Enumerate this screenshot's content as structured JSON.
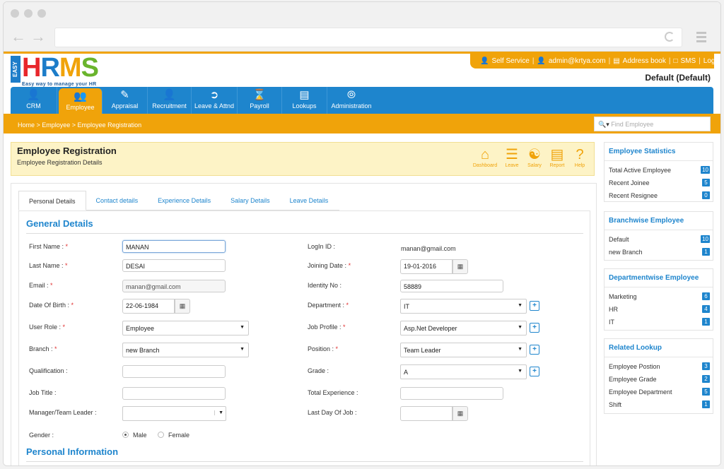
{
  "top_links": {
    "self_service": "Self Service",
    "user": "admin@krtya.com",
    "address_book": "Address book",
    "sms": "SMS",
    "logout": "Logout"
  },
  "logo": {
    "side": "EASY",
    "letters": [
      "H",
      "R",
      "M",
      "S"
    ],
    "tagline": "Easy way to manage your HR",
    "colors": [
      "#e8262b",
      "#1d7dc9",
      "#f0a30a",
      "#6ab42d"
    ]
  },
  "company": "Default (Default)",
  "nav": [
    {
      "label": "CRM",
      "icon": "user-icon"
    },
    {
      "label": "Employee",
      "icon": "users-icon"
    },
    {
      "label": "Appraisal",
      "icon": "edit-icon"
    },
    {
      "label": "Recruitment",
      "icon": "recruit-icon"
    },
    {
      "label": "Leave & Attnd",
      "icon": "exit-icon"
    },
    {
      "label": "Payroll",
      "icon": "hourglass-icon"
    },
    {
      "label": "Lookups",
      "icon": "lookup-icon"
    },
    {
      "label": "Administration",
      "icon": "compass-icon"
    }
  ],
  "breadcrumb": "Home > Employee > Employee Registration",
  "search": {
    "placeholder": "Find Employee"
  },
  "title": {
    "heading": "Employee Registration",
    "sub": "Employee Registration Details"
  },
  "toolbar": [
    "Dashboard",
    "Leave",
    "Salary",
    "Report",
    "Help"
  ],
  "tabs": [
    "Personal Details",
    "Contact details",
    "Experience Details",
    "Salary Details",
    "Leave Details"
  ],
  "sections": {
    "general": "General Details",
    "personal": "Personal Information"
  },
  "form": {
    "first_name": {
      "label": "First Name :",
      "value": "MANAN"
    },
    "last_name": {
      "label": "Last Name :",
      "value": "DESAI"
    },
    "email": {
      "label": "Email :",
      "value": "manan@gmail.com"
    },
    "dob": {
      "label": "Date Of Birth :",
      "value": "22-06-1984"
    },
    "user_role": {
      "label": "User Role :",
      "value": "Employee"
    },
    "branch": {
      "label": "Branch :",
      "value": "new Branch"
    },
    "qualification": {
      "label": "Qualification :",
      "value": ""
    },
    "job_title": {
      "label": "Job Title :",
      "value": ""
    },
    "manager": {
      "label": "Manager/Team Leader :",
      "value": ""
    },
    "gender": {
      "label": "Gender :",
      "options": [
        "Male",
        "Female"
      ],
      "selected": "Male"
    },
    "login_id": {
      "label": "LogIn ID :",
      "value": "manan@gmail.com"
    },
    "joining_date": {
      "label": "Joining Date :",
      "value": "19-01-2016"
    },
    "identity_no": {
      "label": "Identity No :",
      "value": "58889"
    },
    "department": {
      "label": "Department :",
      "value": "IT"
    },
    "job_profile": {
      "label": "Job Profile :",
      "value": "Asp.Net Developer"
    },
    "position": {
      "label": "Position :",
      "value": "Team Leader"
    },
    "grade": {
      "label": "Grade :",
      "value": "A"
    },
    "total_experience": {
      "label": "Total Experience :",
      "value": ""
    },
    "last_day": {
      "label": "Last Day Of Job :",
      "value": ""
    }
  },
  "sidebar": [
    {
      "title": "Employee Statistics",
      "rows": [
        {
          "label": "Total Active Employee",
          "count": "10"
        },
        {
          "label": "Recent Joinee",
          "count": "5"
        },
        {
          "label": "Recent Resignee",
          "count": "0"
        }
      ]
    },
    {
      "title": "Branchwise Employee",
      "rows": [
        {
          "label": "Default",
          "count": "10"
        },
        {
          "label": "new Branch",
          "count": "1"
        }
      ]
    },
    {
      "title": "Departmentwise Employee",
      "rows": [
        {
          "label": "Marketing",
          "count": "6"
        },
        {
          "label": "HR",
          "count": "4"
        },
        {
          "label": "IT",
          "count": "1"
        }
      ]
    },
    {
      "title": "Related Lookup",
      "rows": [
        {
          "label": "Employee Postion",
          "count": "3"
        },
        {
          "label": "Employee Grade",
          "count": "2"
        },
        {
          "label": "Employee Department",
          "count": "5"
        },
        {
          "label": "Shift",
          "count": "1"
        }
      ]
    }
  ]
}
